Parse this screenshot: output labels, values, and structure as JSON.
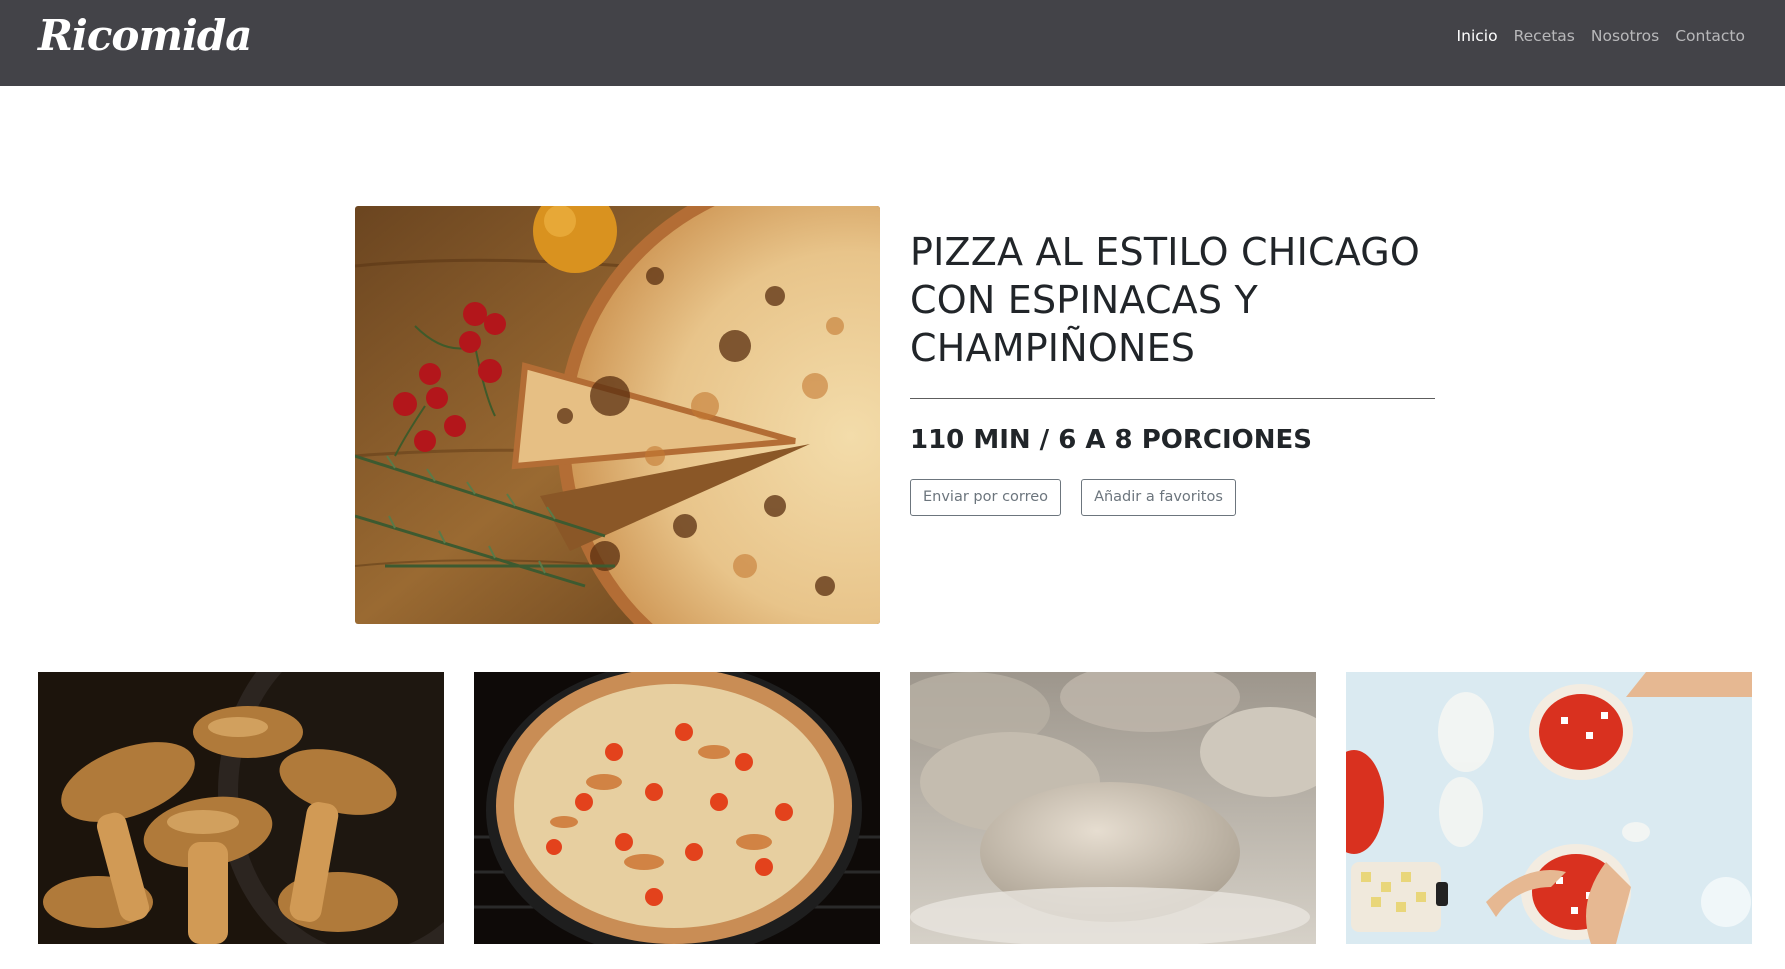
{
  "navbar": {
    "brand": "Ricomida",
    "links": [
      {
        "label": "Inicio",
        "active": true
      },
      {
        "label": "Recetas",
        "active": false
      },
      {
        "label": "Nosotros",
        "active": false
      },
      {
        "label": "Contacto",
        "active": false
      }
    ]
  },
  "hero": {
    "title_lines": [
      "PIZZA AL ESTILO CHICAGO",
      "CON ESPINACAS Y",
      "CHAMPIÑONES"
    ],
    "meta": "110 MIN / 6 A 8 PORCIONES",
    "buttons": {
      "email": "Enviar por correo",
      "favorite": "Añadir a favoritos"
    }
  },
  "gallery": {
    "images": [
      "mushrooms-photo",
      "baked-pizza-photo",
      "dough-photo",
      "pizza-prep-photo"
    ]
  },
  "colors": {
    "navbar_bg": "#434348",
    "text": "#212529",
    "button_outline": "#6c757d"
  }
}
